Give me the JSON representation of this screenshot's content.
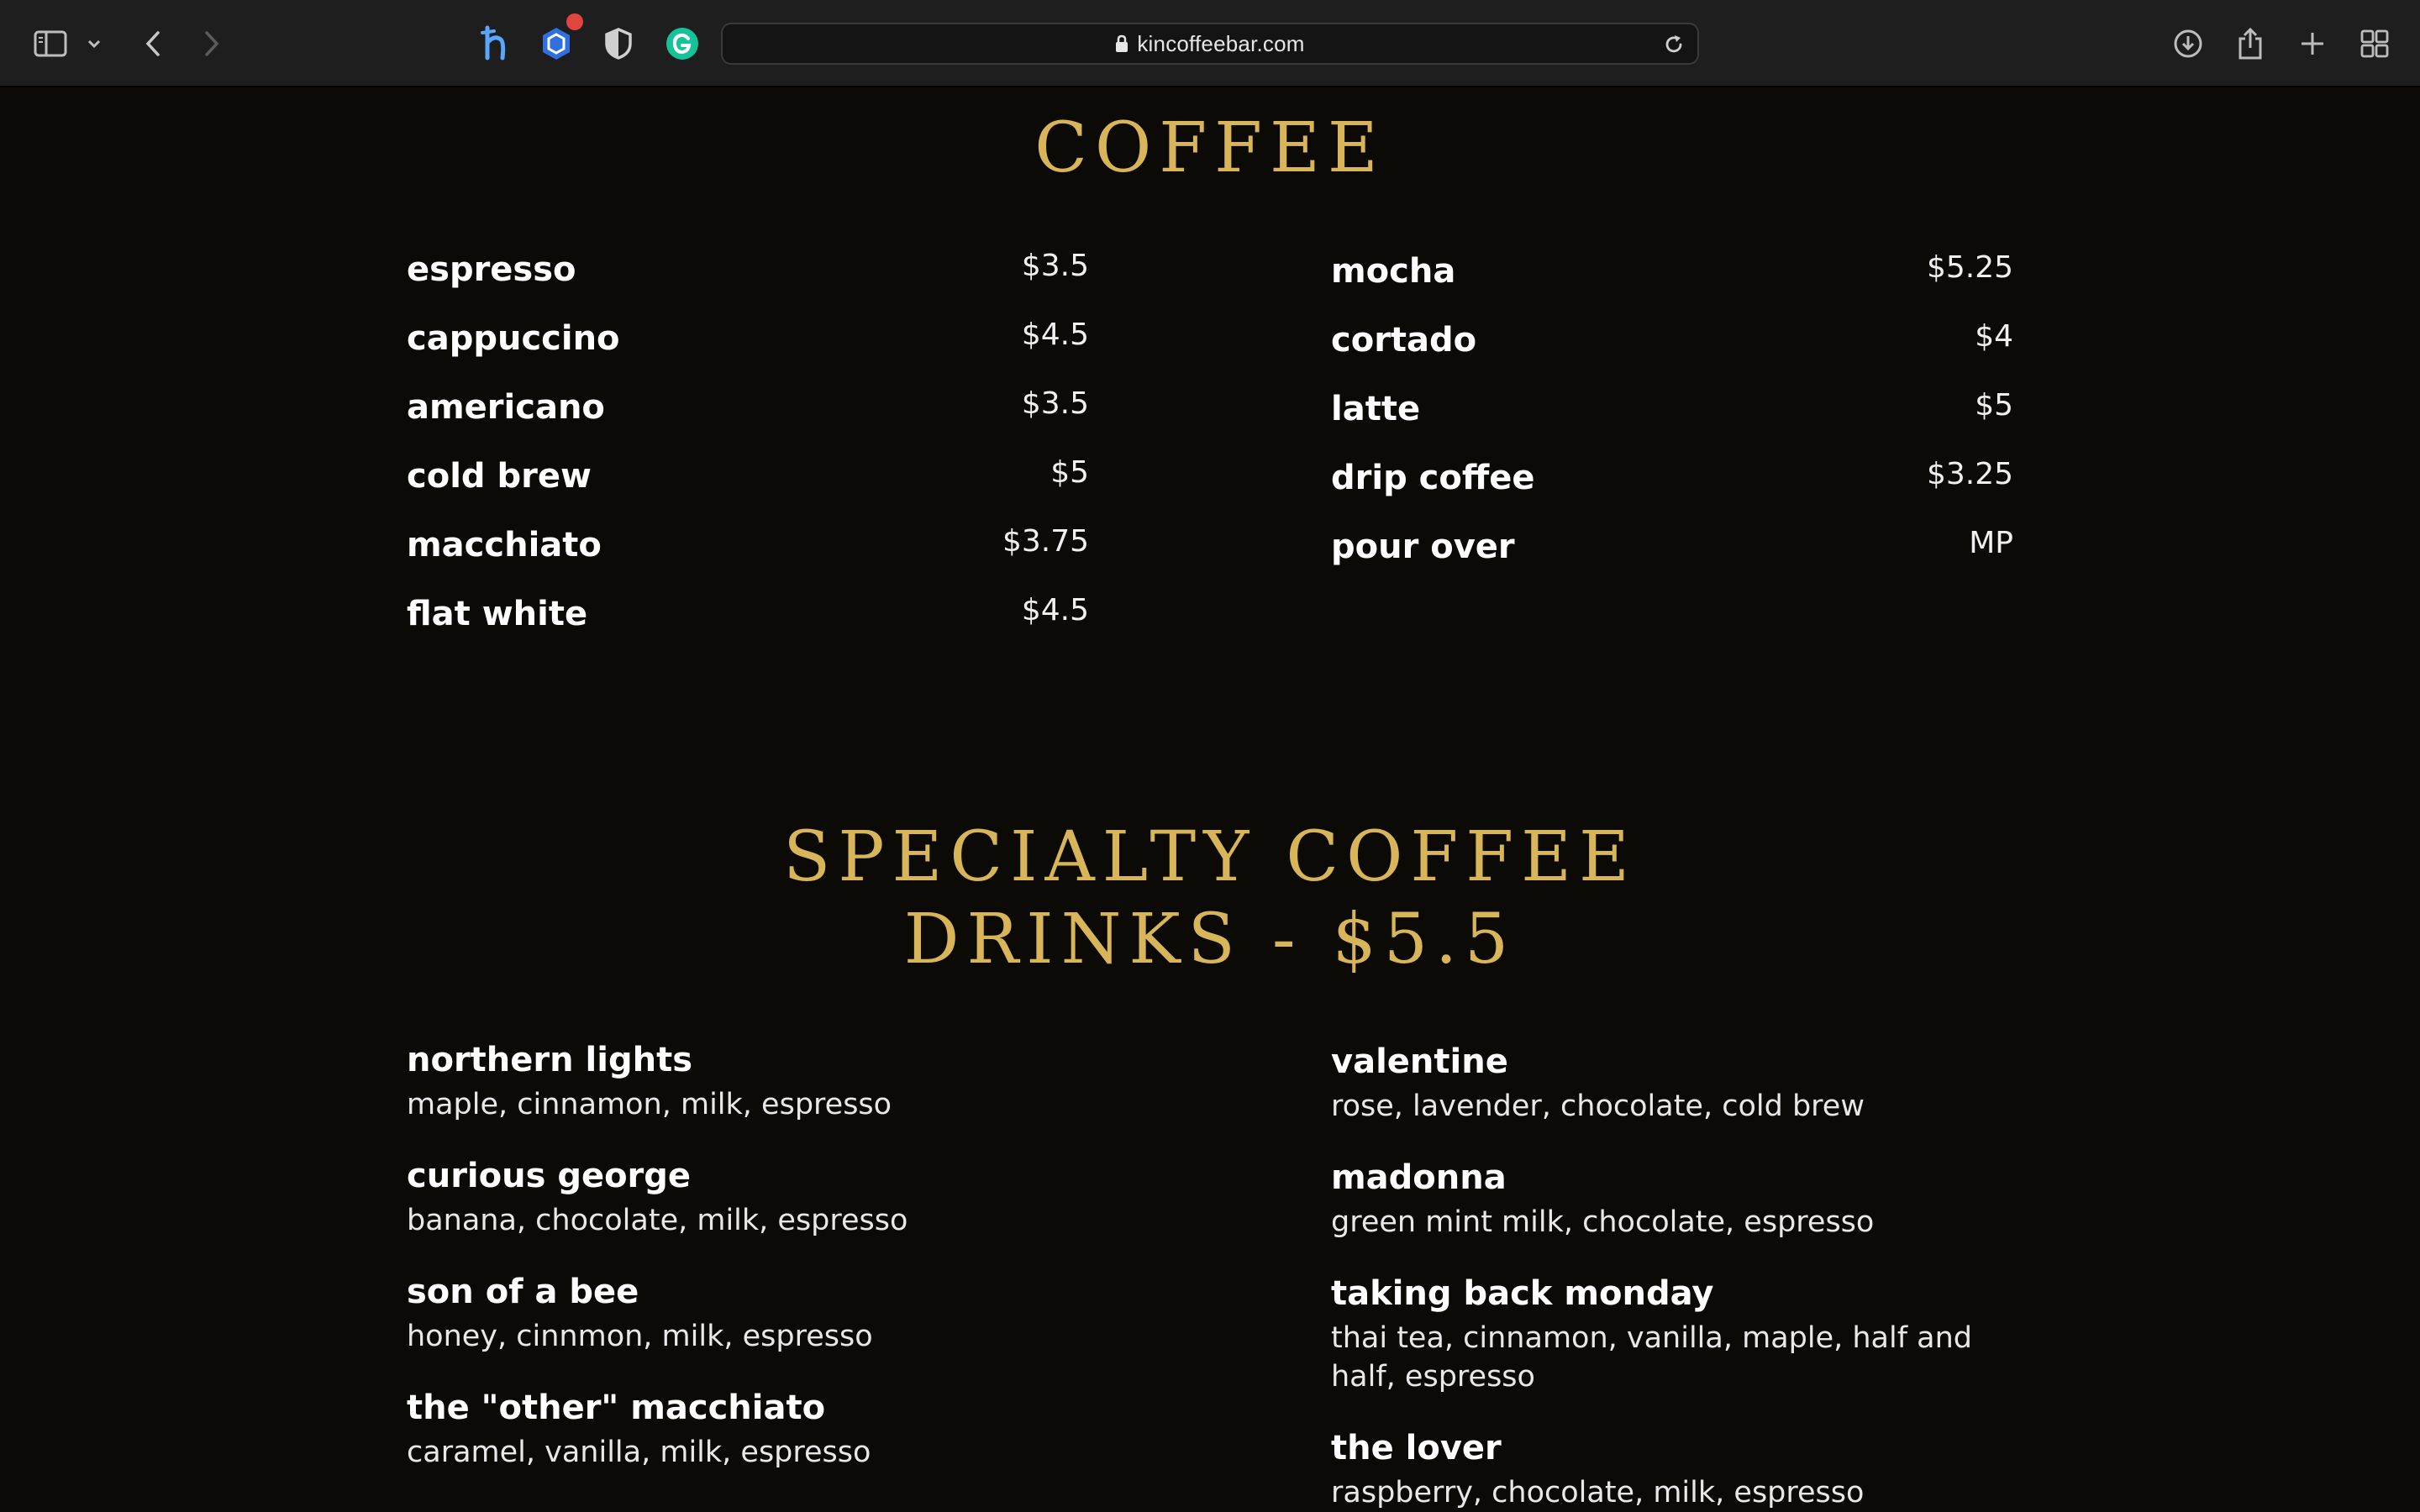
{
  "browser": {
    "url": "kincoffeebar.com",
    "extensions": [
      "honey-extension-icon",
      "privacy-extension-icon",
      "shield-extension-icon",
      "grammarly-extension-icon"
    ]
  },
  "coffee": {
    "title": "COFFEE",
    "left": [
      {
        "name": "espresso",
        "price": "$3.5"
      },
      {
        "name": "cappuccino",
        "price": "$4.5"
      },
      {
        "name": "americano",
        "price": "$3.5"
      },
      {
        "name": "cold brew",
        "price": "$5"
      },
      {
        "name": "macchiato",
        "price": "$3.75"
      },
      {
        "name": "flat white",
        "price": "$4.5"
      }
    ],
    "right": [
      {
        "name": "mocha",
        "price": "$5.25"
      },
      {
        "name": "cortado",
        "price": "$4"
      },
      {
        "name": "latte",
        "price": "$5"
      },
      {
        "name": "drip coffee",
        "price": "$3.25"
      },
      {
        "name": "pour over",
        "price": "MP"
      }
    ]
  },
  "specialty": {
    "title_line1": "SPECIALTY COFFEE",
    "title_line2": "DRINKS - $5.5",
    "left": [
      {
        "name": "northern lights",
        "desc": "maple, cinnamon, milk, espresso"
      },
      {
        "name": "curious george",
        "desc": "banana, chocolate, milk, espresso"
      },
      {
        "name": "son of a bee",
        "desc": "honey, cinnmon, milk, espresso"
      },
      {
        "name": "the \"other\" macchiato",
        "desc": "caramel, vanilla, milk, espresso"
      }
    ],
    "right": [
      {
        "name": "valentine",
        "desc": "rose, lavender, chocolate, cold brew"
      },
      {
        "name": "madonna",
        "desc": "green mint milk, chocolate, espresso"
      },
      {
        "name": "taking back monday",
        "desc": "thai tea, cinnamon, vanilla, maple, half and half, espresso"
      },
      {
        "name": "the lover",
        "desc": "raspberry, chocolate, milk, espresso"
      }
    ]
  }
}
